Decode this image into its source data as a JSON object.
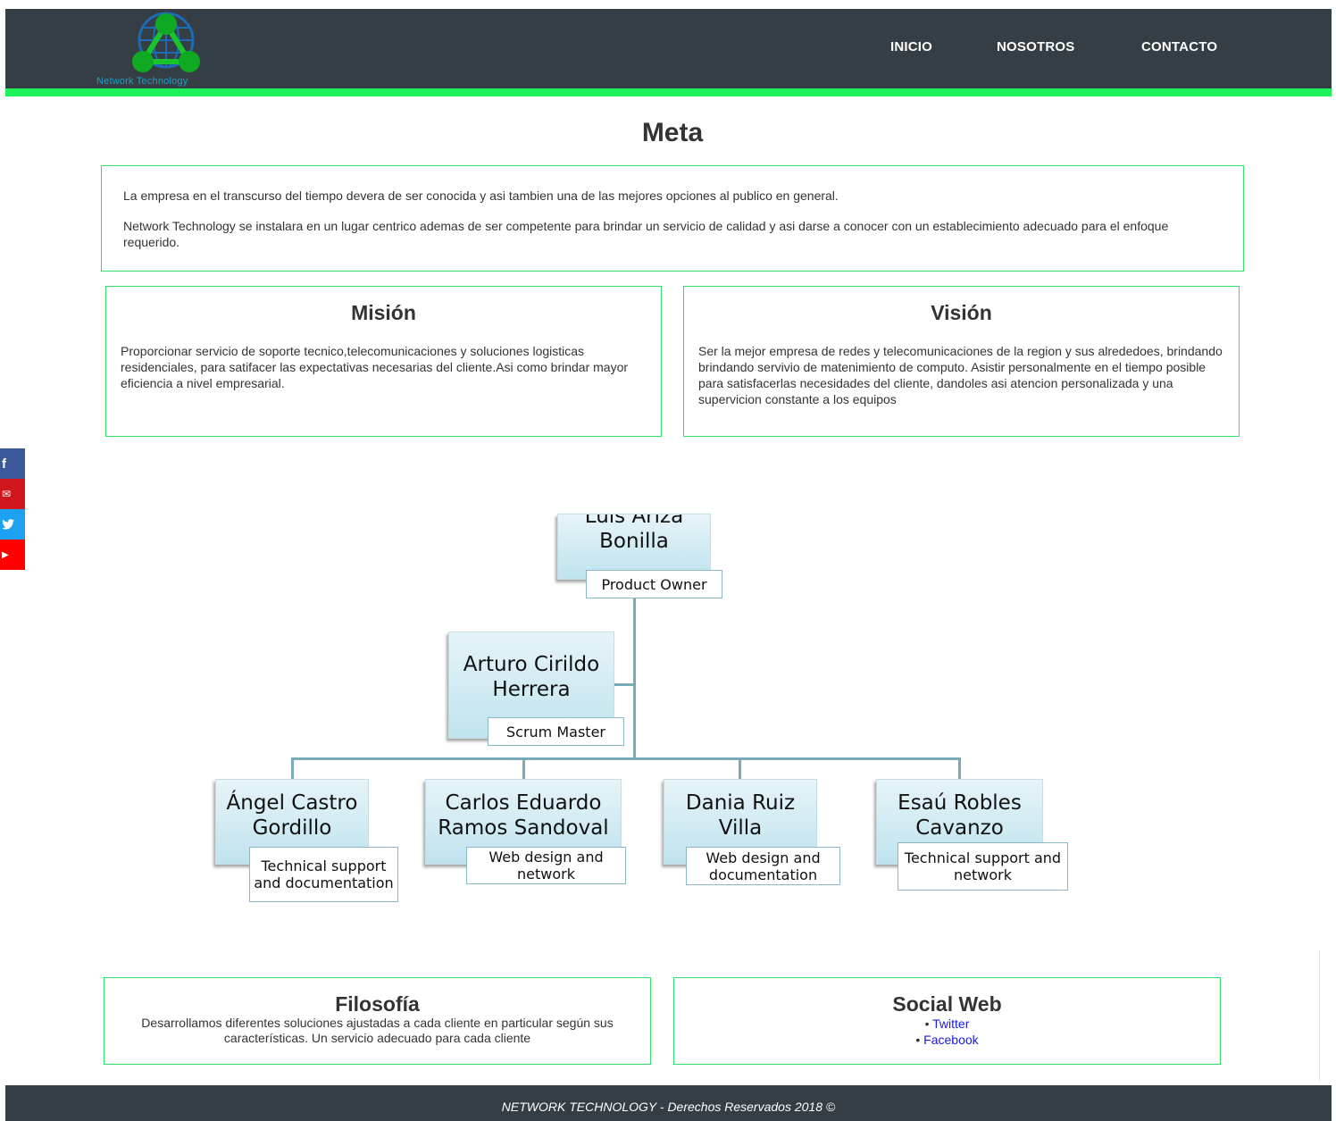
{
  "header": {
    "logo_text": "Network Technology",
    "nav": [
      {
        "label": "INICIO"
      },
      {
        "label": "NOSOTROS"
      },
      {
        "label": "CONTACTO"
      }
    ],
    "colors": {
      "bar": "#353e44",
      "accent": "#1ef25b"
    }
  },
  "meta": {
    "title": "Meta",
    "paragraphs": [
      "La empresa en el transcurso del tiempo devera de ser conocida y asi tambien una de las mejores opciones al publico en general.",
      "Network Technology se instalara en un lugar centrico ademas de ser competente para brindar un servicio de calidad y asi darse a conocer con un establecimiento adecuado para el enfoque requerido."
    ]
  },
  "mision": {
    "title": "Misión",
    "text": "Proporcionar servicio de soporte tecnico,telecomunicaciones y soluciones logisticas residenciales, para satifacer las expectativas necesarias del cliente.Asi como brindar mayor eficiencia a nivel empresarial."
  },
  "vision": {
    "title": "Visión",
    "text": "Ser la mejor empresa de redes y telecomunicaciones de la region y sus alrededoes, brindando brindando servivio de matenimiento de computo. Asistir personalmente en el tiempo posible para satisfacerlas necesidades del cliente, dandoles asi atencion personalizada y una supervicion constante a los equipos"
  },
  "social_sidebar": [
    {
      "icon": "facebook-icon",
      "glyph": "f",
      "color": "#3b5998"
    },
    {
      "icon": "mail-icon",
      "glyph": "✉",
      "color": "#d0171e"
    },
    {
      "icon": "twitter-icon",
      "glyph": "🐦",
      "color": "#1da1f2"
    },
    {
      "icon": "youtube-icon",
      "glyph": "▶",
      "color": "#ff0000"
    }
  ],
  "org_chart": {
    "owner": {
      "name_line1": "Luis Ariza",
      "name_line2": "Bonilla",
      "role": "Product Owner"
    },
    "scrum": {
      "name_line1": "Arturo Cirildo",
      "name_line2": "Herrera",
      "role": "Scrum Master"
    },
    "team": [
      {
        "name_line1": "Ángel Castro",
        "name_line2": "Gordillo",
        "role_line1": "Technical support",
        "role_line2": "and documentation"
      },
      {
        "name_line1": "Carlos Eduardo",
        "name_line2": "Ramos Sandoval",
        "role_line1": "Web design and",
        "role_line2": "network"
      },
      {
        "name_line1": "Dania Ruiz",
        "name_line2": "Villa",
        "role_line1": "Web design and",
        "role_line2": "documentation"
      },
      {
        "name_line1": "Esaú Robles",
        "name_line2": "Cavanzo",
        "role_line1": "Technical support and",
        "role_line2": "network"
      }
    ]
  },
  "filosofia": {
    "title": "Filosofía",
    "text": "Desarrollamos diferentes soluciones ajustadas a cada cliente en particular según sus características. Un servicio adecuado para cada cliente"
  },
  "social_web": {
    "title": "Social Web",
    "links": [
      "Twitter",
      "Facebook"
    ]
  },
  "footer": {
    "text": "NETWORK TECHNOLOGY - Derechos Reservados 2018 ©"
  }
}
